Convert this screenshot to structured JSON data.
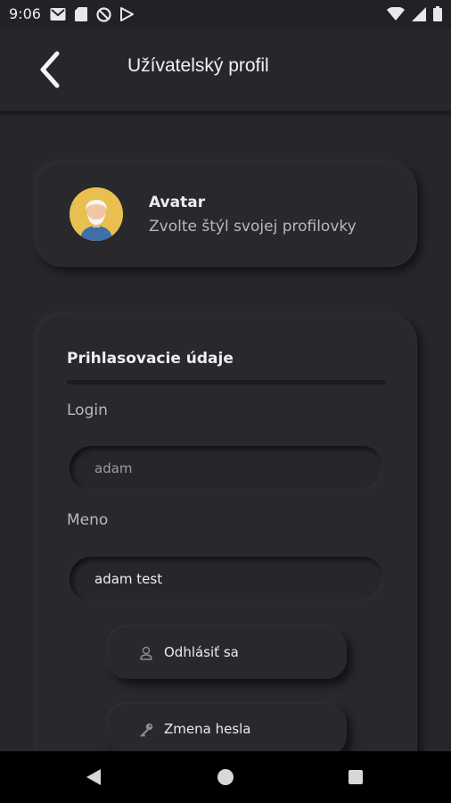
{
  "status_bar": {
    "time": "9:06",
    "left_icons": [
      "gmail-icon",
      "sd-card-icon",
      "do-not-disturb-icon",
      "play-store-icon"
    ],
    "right_icons": [
      "wifi-icon",
      "signal-icon",
      "battery-icon"
    ]
  },
  "header": {
    "title": "Užívatelský profil",
    "back_icon": "chevron-left-icon"
  },
  "avatar_card": {
    "title": "Avatar",
    "subtitle": "Zvolte štýl svojej profilovky"
  },
  "login_section": {
    "title": "Prihlasovacie údaje",
    "login_label": "Login",
    "login_value": "adam",
    "name_label": "Meno",
    "name_value": "adam test",
    "logout_label": "Odhlásiť sa",
    "logout_icon": "user-icon",
    "change_password_label": "Zmena hesla",
    "change_password_icon": "key-icon"
  },
  "colors": {
    "background": "#26262b",
    "card": "#28282d",
    "avatar_bg": "#e9c04f"
  }
}
